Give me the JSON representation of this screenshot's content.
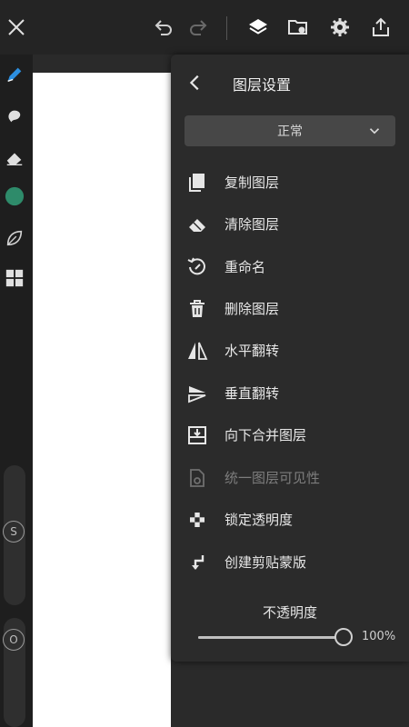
{
  "toolbar": {
    "icons": [
      "close-icon",
      "undo-icon",
      "redo-icon",
      "layers-icon",
      "folder-image-icon",
      "gear-icon",
      "share-icon"
    ]
  },
  "leftbar": {
    "tools": [
      "pen-tool-icon",
      "smudge-tool-icon",
      "eraser-icon",
      "color-swatch",
      "leaf-icon",
      "grid-icon"
    ],
    "color_swatch": "#2e8b6a",
    "size_badge": "S",
    "opacity_badge": "O"
  },
  "panel": {
    "title": "图层设置",
    "blend_mode": "正常",
    "items": [
      {
        "label": "复制图层",
        "icon": "duplicate-layer-icon",
        "enabled": true
      },
      {
        "label": "清除图层",
        "icon": "eraser-icon",
        "enabled": true
      },
      {
        "label": "重命名",
        "icon": "rename-icon",
        "enabled": true
      },
      {
        "label": "删除图层",
        "icon": "trash-icon",
        "enabled": true
      },
      {
        "label": "水平翻转",
        "icon": "flip-horizontal-icon",
        "enabled": true
      },
      {
        "label": "垂直翻转",
        "icon": "flip-vertical-icon",
        "enabled": true
      },
      {
        "label": "向下合并图层",
        "icon": "merge-down-icon",
        "enabled": true
      },
      {
        "label": "统一图层可见性",
        "icon": "visibility-icon",
        "enabled": false
      },
      {
        "label": "锁定透明度",
        "icon": "checker-lock-icon",
        "enabled": true
      },
      {
        "label": "创建剪贴蒙版",
        "icon": "clip-mask-icon",
        "enabled": true
      }
    ],
    "opacity_label": "不透明度",
    "opacity_value_text": "100%",
    "opacity_value": 1.0
  }
}
